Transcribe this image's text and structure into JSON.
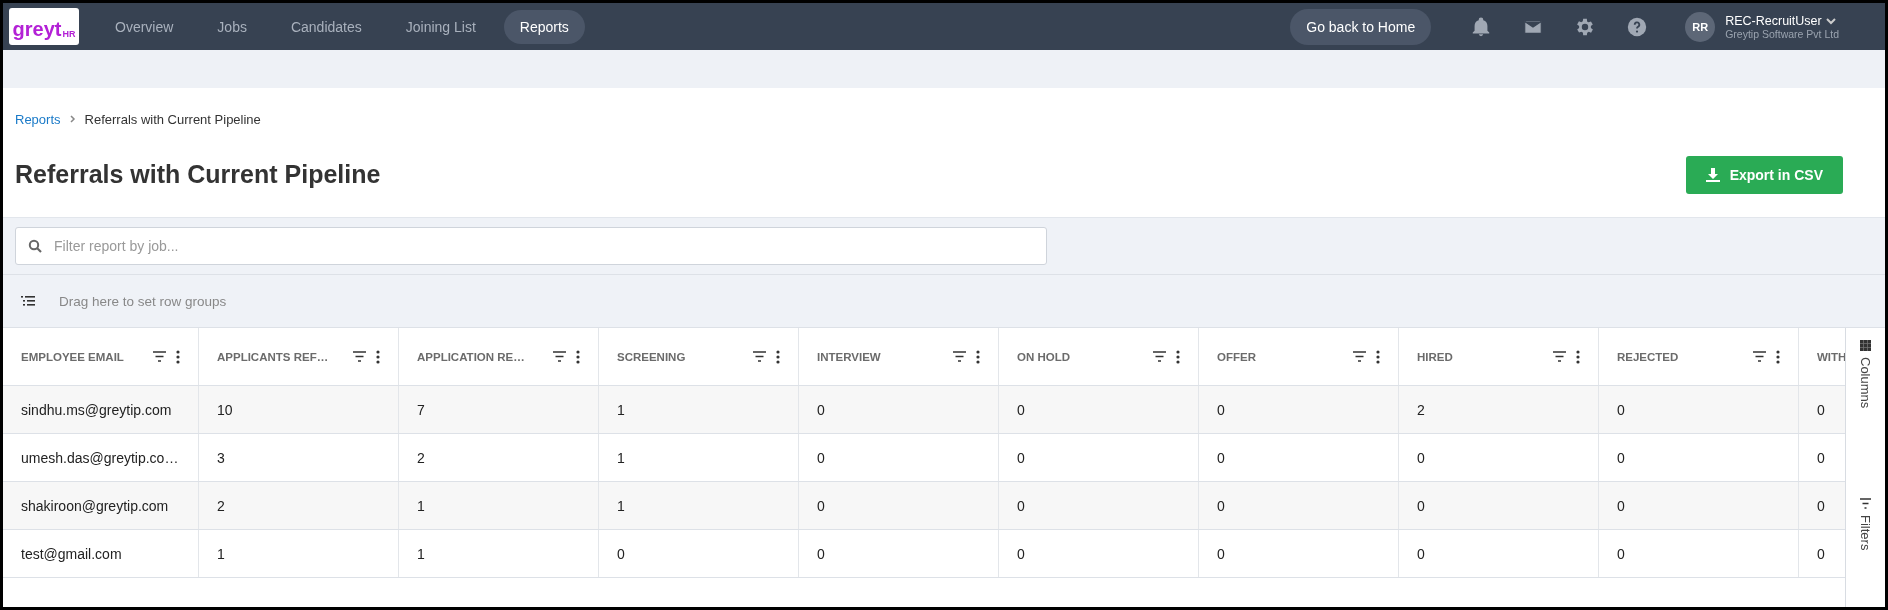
{
  "nav": {
    "logo": {
      "text": "greyt",
      "sub": "HR"
    },
    "items": [
      {
        "label": "Overview",
        "selected": false
      },
      {
        "label": "Jobs",
        "selected": false
      },
      {
        "label": "Candidates",
        "selected": false
      },
      {
        "label": "Joining List",
        "selected": false
      },
      {
        "label": "Reports",
        "selected": true
      }
    ],
    "home_button": "Go back to Home",
    "user": {
      "initials": "RR",
      "name": "REC-RecruitUser",
      "company": "Greytip Software Pvt Ltd"
    }
  },
  "breadcrumb": [
    {
      "label": "Reports",
      "kind": "link"
    },
    {
      "label": "Referrals with Current Pipeline",
      "kind": "current"
    }
  ],
  "title": "Referrals with Current Pipeline",
  "export_button": "Export in CSV",
  "filter": {
    "placeholder": "Filter report by job..."
  },
  "row_groups": {
    "text": "Drag here to set row groups"
  },
  "table": {
    "columns": [
      "EMPLOYEE EMAIL",
      "APPLICANTS REF…",
      "APPLICATION RE…",
      "SCREENING",
      "INTERVIEW",
      "ON HOLD",
      "OFFER",
      "HIRED",
      "REJECTED",
      "WITH"
    ],
    "rows": [
      [
        "sindhu.ms@greytip.com",
        "10",
        "7",
        "1",
        "0",
        "0",
        "0",
        "2",
        "0",
        "0"
      ],
      [
        "umesh.das@greytip.co…",
        "3",
        "2",
        "1",
        "0",
        "0",
        "0",
        "0",
        "0",
        "0"
      ],
      [
        "shakiroon@greytip.com",
        "2",
        "1",
        "1",
        "0",
        "0",
        "0",
        "0",
        "0",
        "0"
      ],
      [
        "test@gmail.com",
        "1",
        "1",
        "0",
        "0",
        "0",
        "0",
        "0",
        "0",
        "0"
      ]
    ]
  },
  "side_panel": [
    {
      "label": "Columns",
      "kind": "columns"
    },
    {
      "label": "Filters",
      "kind": "filters"
    }
  ]
}
